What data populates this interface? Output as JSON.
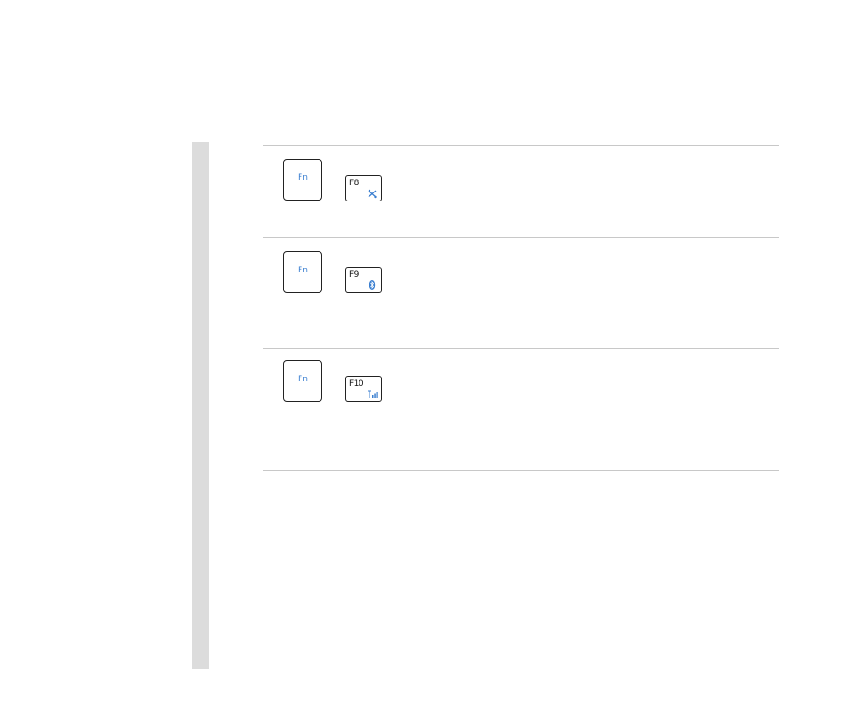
{
  "rows": [
    {
      "modifier_key": "Fn",
      "function_key": "F8",
      "function_icon": "wlan-icon"
    },
    {
      "modifier_key": "Fn",
      "function_key": "F9",
      "function_icon": "bluetooth-icon"
    },
    {
      "modifier_key": "Fn",
      "function_key": "F10",
      "function_icon": "3g-signal-icon"
    }
  ],
  "colors": {
    "fn_label": "#3b7fd0",
    "icon": "#3b7fd0",
    "sidebar_band": "#dcdcdc",
    "divider": "#c8c8c8"
  }
}
